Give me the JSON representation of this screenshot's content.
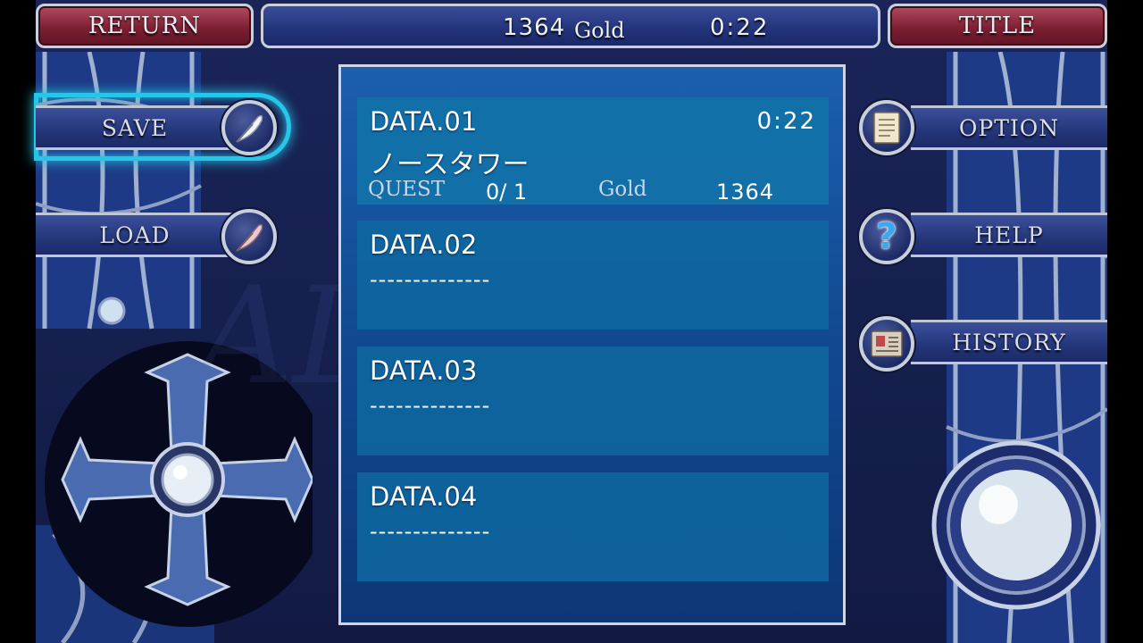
{
  "top_bar": {
    "return_label": "RETURN",
    "title_label": "TITLE",
    "gold_amount": "1364",
    "gold_unit": "Gold",
    "play_time": "0:22"
  },
  "left_menu": {
    "save_label": "SAVE",
    "load_label": "LOAD"
  },
  "right_menu": {
    "option_label": "OPTION",
    "help_label": "HELP",
    "history_label": "HISTORY"
  },
  "slots": [
    {
      "label": "DATA.01",
      "time": "0:22",
      "location": "ノースタワー",
      "quest_label": "QUEST",
      "quest_value": "0/ 1",
      "gold_label": "Gold",
      "gold_value": "1364"
    },
    {
      "label": "DATA.02",
      "empty": "--------------"
    },
    {
      "label": "DATA.03",
      "empty": "--------------"
    },
    {
      "label": "DATA.04",
      "empty": "--------------"
    }
  ],
  "colors": {
    "frame": "#1b2458",
    "panel": "#1b5fae",
    "slot": "#0e68a0",
    "top_button": "#7e1f33",
    "highlight": "#25c6e8"
  }
}
